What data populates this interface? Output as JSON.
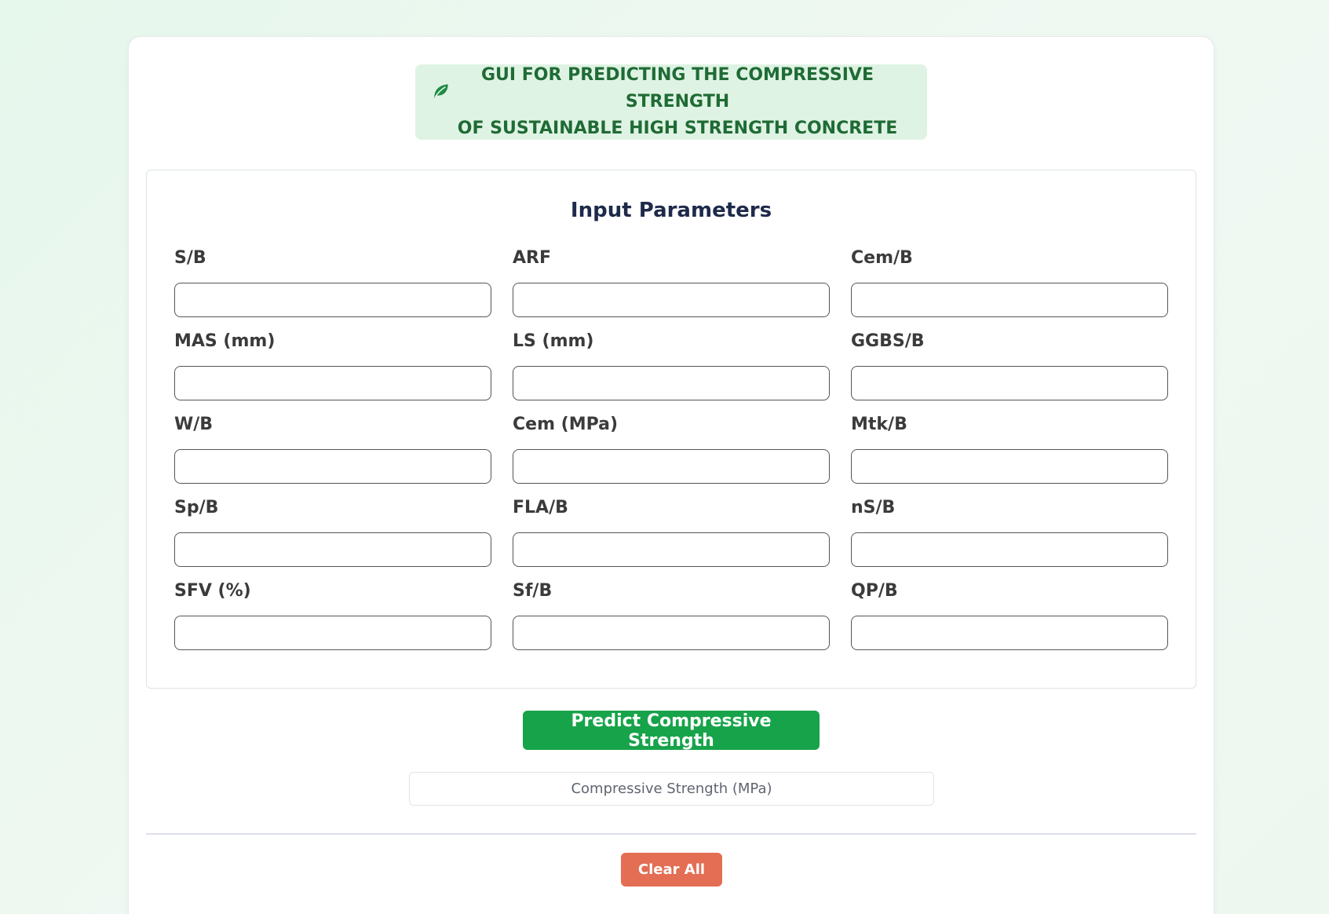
{
  "header": {
    "title_line1": "GUI FOR PREDICTING THE COMPRESSIVE STRENGTH",
    "title_line2": "OF SUSTAINABLE HIGH STRENGTH CONCRETE",
    "icon": "leaf-icon",
    "color": "#1f6b35",
    "background": "#dff3e4"
  },
  "params": {
    "title": "Input Parameters",
    "fields": [
      {
        "label": "S/B",
        "value": ""
      },
      {
        "label": "ARF",
        "value": ""
      },
      {
        "label": "Cem/B",
        "value": ""
      },
      {
        "label": "MAS (mm)",
        "value": ""
      },
      {
        "label": "LS (mm)",
        "value": ""
      },
      {
        "label": "GGBS/B",
        "value": ""
      },
      {
        "label": "W/B",
        "value": ""
      },
      {
        "label": "Cem (MPa)",
        "value": ""
      },
      {
        "label": "Mtk/B",
        "value": ""
      },
      {
        "label": "Sp/B",
        "value": ""
      },
      {
        "label": "FLA/B",
        "value": ""
      },
      {
        "label": "nS/B",
        "value": ""
      },
      {
        "label": "SFV (%)",
        "value": ""
      },
      {
        "label": "Sf/B",
        "value": ""
      },
      {
        "label": "QP/B",
        "value": ""
      }
    ]
  },
  "actions": {
    "predict_label": "Predict Compressive Strength",
    "predict_color": "#17a34a",
    "result_placeholder": "Compressive Strength (MPa)",
    "clear_label": "Clear All",
    "clear_color": "#e36e53"
  }
}
